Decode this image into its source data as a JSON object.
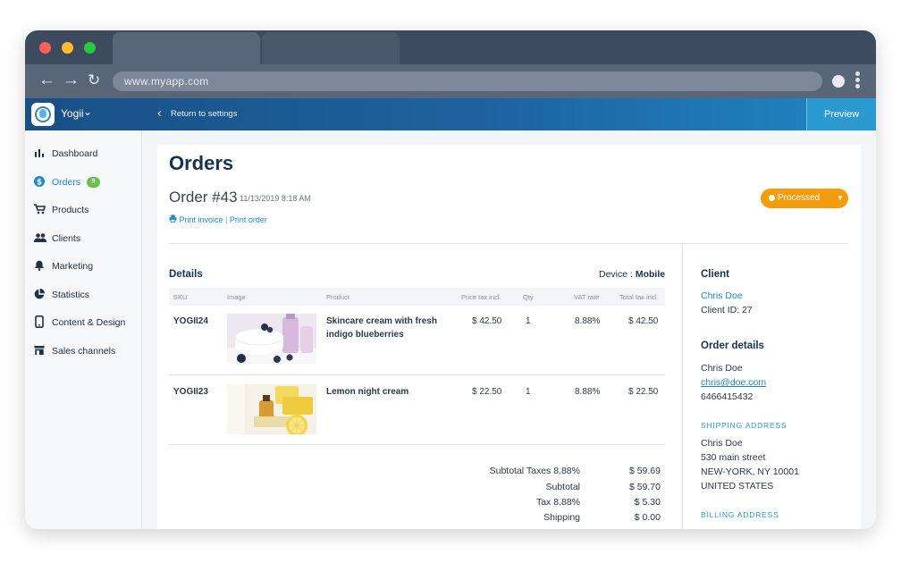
{
  "browser": {
    "url": "www.myapp.com",
    "colors": {
      "close": "#fe5f57",
      "minimize": "#febc2e",
      "zoom": "#28c840"
    }
  },
  "appbar": {
    "brand": "Yogii",
    "back_label": "Return to settings",
    "preview_label": "Preview"
  },
  "sidebar": {
    "items": [
      {
        "label": "Dashboard",
        "icon": "bar-chart-icon"
      },
      {
        "label": "Orders",
        "icon": "dollar-icon",
        "badge": "9",
        "active": true
      },
      {
        "label": "Products",
        "icon": "cart-icon"
      },
      {
        "label": "Clients",
        "icon": "people-icon"
      },
      {
        "label": "Marketing",
        "icon": "bell-icon"
      },
      {
        "label": "Statistics",
        "icon": "pie-chart-icon"
      },
      {
        "label": "Content & Design",
        "icon": "phone-icon"
      },
      {
        "label": "Sales channels",
        "icon": "store-icon"
      }
    ]
  },
  "main": {
    "title": "Orders",
    "order_number": "Order #43",
    "order_date": "11/13/2019 8:18 AM",
    "print_invoice": "Print invoice",
    "print_sep": " | ",
    "print_order": "Print order",
    "status": "Processed",
    "status_color": "#f59c0e"
  },
  "details": {
    "title": "Details",
    "device_label": "Device : ",
    "device_value": "Mobile",
    "columns": [
      "SKU",
      "Image",
      "Product",
      "Price tax incl.",
      "Qty",
      "VAT rate",
      "Total tax incl."
    ],
    "rows": [
      {
        "sku": "YOGII24",
        "product": "Skincare cream with fresh indigo blueberries",
        "price": "$ 42.50",
        "qty": "1",
        "vat": "8.88%",
        "total": "$ 42.50"
      },
      {
        "sku": "YOGII23",
        "product": "Lemon night cream",
        "price": "$ 22.50",
        "qty": "1",
        "vat": "8.88%",
        "total": "$ 22.50"
      }
    ],
    "totals": [
      {
        "label": "Subtotal Taxes 8.88%",
        "value": "$ 59.69"
      },
      {
        "label": "Subtotal",
        "value": "$ 59.70"
      },
      {
        "label": "Tax 8.88%",
        "value": "$ 5.30"
      },
      {
        "label": "Shipping",
        "value": "$ 0.00"
      }
    ]
  },
  "client": {
    "title": "Client",
    "name": "Chris Doe",
    "client_id": "Client ID: 27"
  },
  "order_details": {
    "title": "Order details",
    "name": "Chris Doe",
    "email": "chris@doe.com",
    "phone": "6466415432",
    "shipping_title": "SHIPPING ADDRESS",
    "shipping_lines": [
      "Chris Doe",
      "530 main street",
      "NEW-YORK, NY 10001",
      "UNITED STATES"
    ],
    "billing_title": "BILLING ADDRESS"
  }
}
